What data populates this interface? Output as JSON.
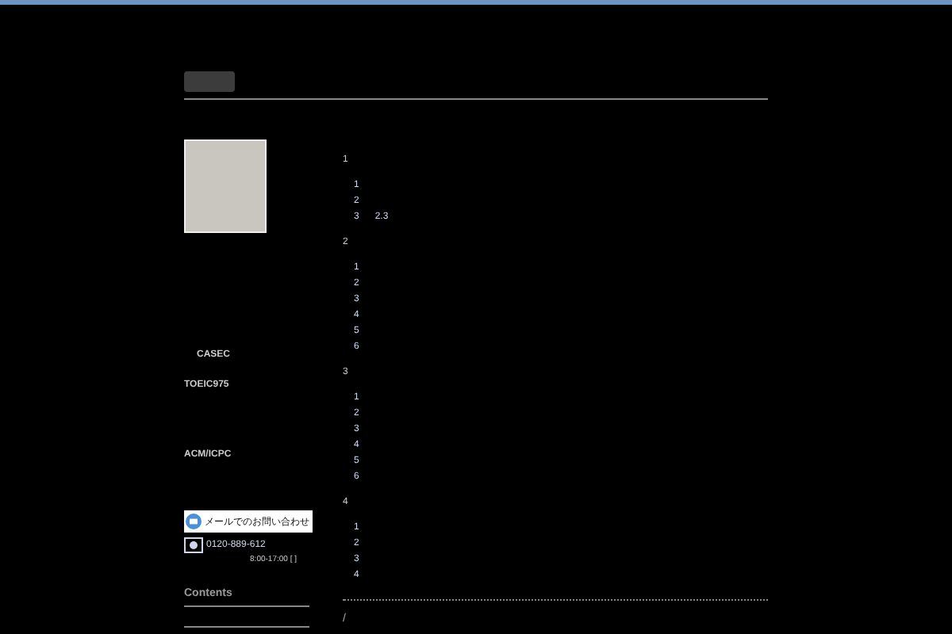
{
  "sidebar": {
    "labels": [
      {
        "text": "CASEC"
      },
      {
        "text": "TOEIC975"
      },
      {
        "text": "ACM/ICPC"
      }
    ],
    "contact_button": {
      "label": "メールでのお問い合わせ"
    },
    "phone": "0120-889-612",
    "hours": "8:00-17:00 [ ]",
    "heading": "Contents"
  },
  "main": {
    "sections": [
      {
        "number": "1",
        "items": [
          {
            "number": "1"
          },
          {
            "number": "2"
          },
          {
            "number": "3",
            "note": "2.3"
          }
        ]
      },
      {
        "number": "2",
        "items": [
          {
            "number": "1"
          },
          {
            "number": "2"
          },
          {
            "number": "3"
          },
          {
            "number": "4"
          },
          {
            "number": "5"
          },
          {
            "number": "6"
          }
        ]
      },
      {
        "number": "3",
        "items": [
          {
            "number": "1"
          },
          {
            "number": "2"
          },
          {
            "number": "3"
          },
          {
            "number": "4"
          },
          {
            "number": "5"
          },
          {
            "number": "6"
          }
        ]
      },
      {
        "number": "4",
        "items": [
          {
            "number": "1"
          },
          {
            "number": "2"
          },
          {
            "number": "3"
          },
          {
            "number": "4"
          }
        ]
      }
    ],
    "footer_mark": "/"
  }
}
